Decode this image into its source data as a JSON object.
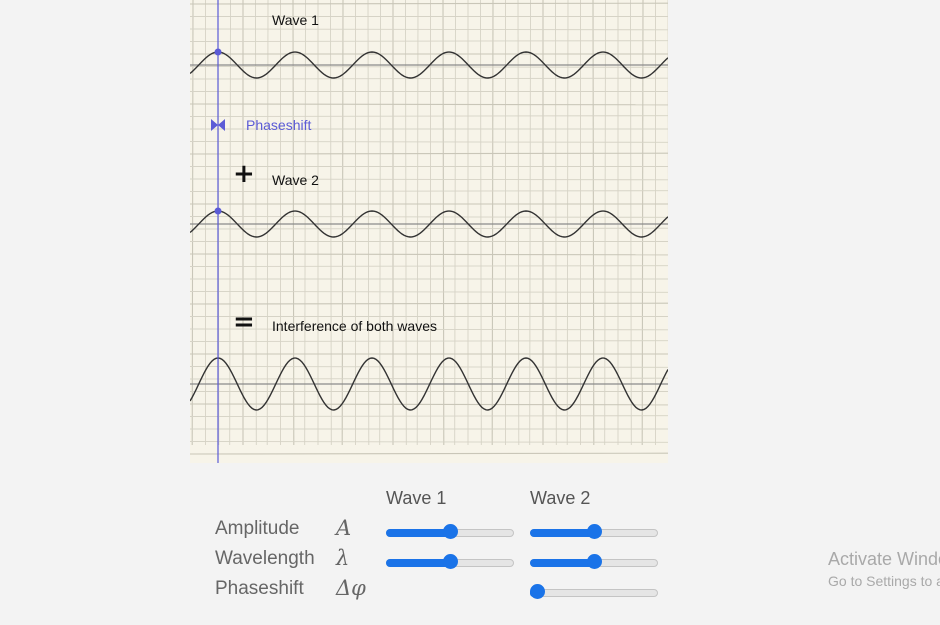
{
  "canvas": {
    "wave1_label": "Wave 1",
    "wave2_label": "Wave 2",
    "interference_label": "Interference of both waves",
    "phaseshift_label": "Phaseshift",
    "plus_symbol": "+",
    "equals_symbol": "="
  },
  "controls": {
    "headers": {
      "wave1": "Wave 1",
      "wave2": "Wave 2"
    },
    "rows": {
      "amplitude": {
        "label": "Amplitude",
        "symbol": "A"
      },
      "wavelength": {
        "label": "Wavelength",
        "symbol": "λ"
      },
      "phaseshift": {
        "label": "Phaseshift",
        "symbol": "Δφ"
      }
    },
    "sliders": {
      "wave1_amplitude": 0.5,
      "wave2_amplitude": 0.5,
      "wave1_wavelength": 0.5,
      "wave2_wavelength": 0.5,
      "wave2_phaseshift": 0.0
    }
  },
  "watermark": {
    "title": "Activate Windows",
    "subtitle": "Go to Settings to activate Windows."
  },
  "colors": {
    "slider_accent": "#1a73e8",
    "phase_line": "#5b5bd6",
    "paper": "#f7f4e9",
    "wave": "#333333"
  }
}
